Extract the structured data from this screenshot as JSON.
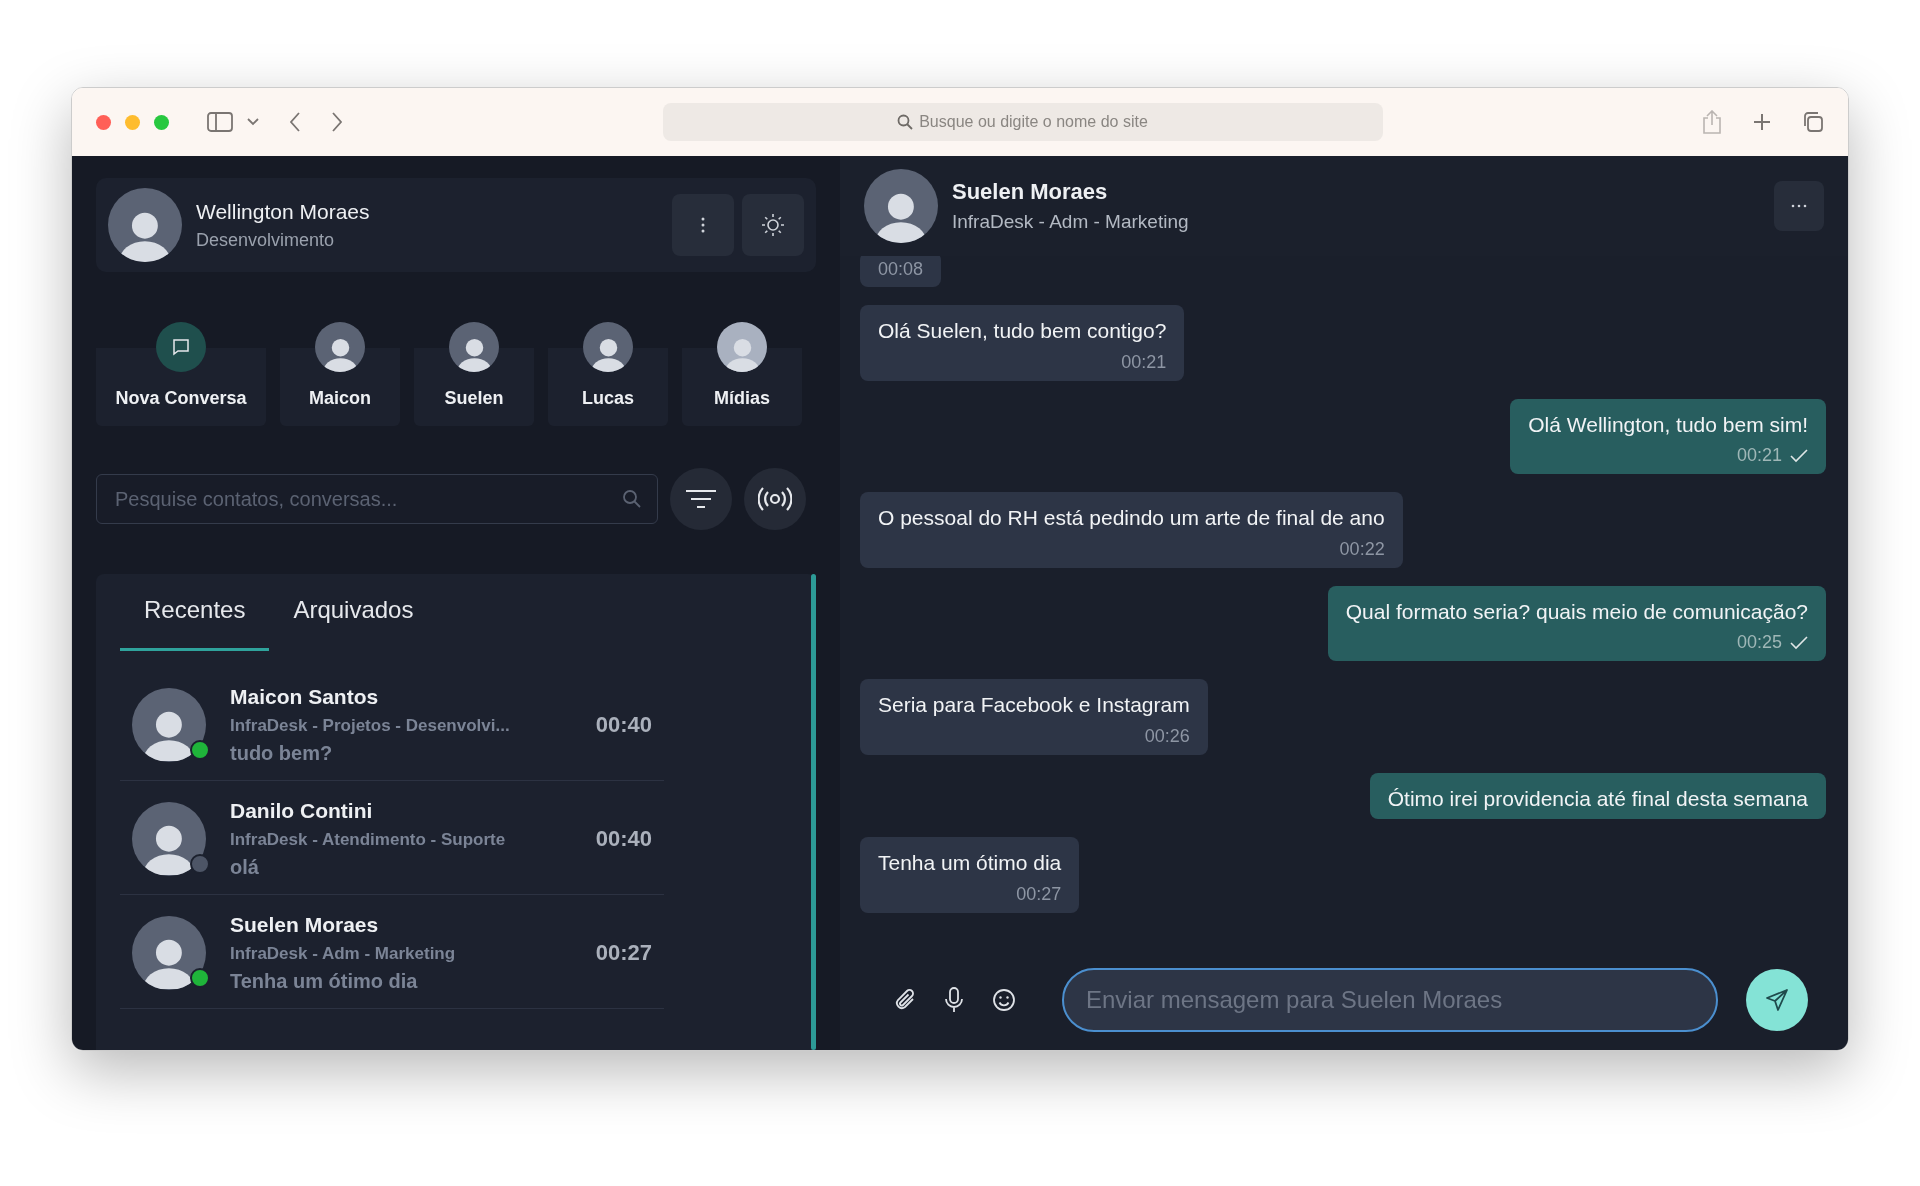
{
  "browser": {
    "address_placeholder": "Busque ou digite o nome do site"
  },
  "profile": {
    "name": "Wellington Moraes",
    "role": "Desenvolvimento"
  },
  "shortcuts": [
    {
      "kind": "action",
      "label": "Nova Conversa"
    },
    {
      "kind": "contact",
      "label": "Maicon"
    },
    {
      "kind": "contact",
      "label": "Suelen"
    },
    {
      "kind": "contact",
      "label": "Lucas"
    },
    {
      "kind": "media",
      "label": "Mídias"
    }
  ],
  "search": {
    "placeholder": "Pesquise contatos, conversas..."
  },
  "tabs": [
    {
      "label": "Recentes",
      "selected": true
    },
    {
      "label": "Arquivados",
      "selected": false
    }
  ],
  "conversations": [
    {
      "name": "Maicon Santos",
      "group": "InfraDesk - Projetos - Desenvolvi...",
      "preview": "tudo bem?",
      "time": "00:40",
      "online": true
    },
    {
      "name": "Danilo Contini",
      "group": "InfraDesk - Atendimento - Suporte",
      "preview": "olá",
      "time": "00:40",
      "online": false
    },
    {
      "name": "Suelen Moraes",
      "group": "InfraDesk - Adm - Marketing",
      "preview": "Tenha um ótimo dia",
      "time": "00:27",
      "online": true
    }
  ],
  "chat": {
    "name": "Suelen Moraes",
    "group": "InfraDesk - Adm - Marketing",
    "messages": [
      {
        "kind": "received",
        "time": "00:08",
        "check": false
      },
      {
        "kind": "received",
        "text": "Olá Suelen, tudo bem contigo?",
        "time": "00:21",
        "check": false
      },
      {
        "kind": "sent",
        "text": "Olá Wellington, tudo bem sim!",
        "time": "00:21",
        "check": true
      },
      {
        "kind": "received",
        "text": "O pessoal do RH está pedindo um arte de final de ano",
        "time": "00:22",
        "check": false
      },
      {
        "kind": "sent",
        "text": "Qual formato seria? quais meio de comunicação?",
        "time": "00:25",
        "check": true
      },
      {
        "kind": "received",
        "text": "Seria para Facebook e Instagram",
        "time": "00:26",
        "check": false
      },
      {
        "kind": "sent",
        "text": "Ótimo irei providencia até final desta semana",
        "check": false
      },
      {
        "kind": "received",
        "text": "Tenha um ótimo dia",
        "time": "00:27",
        "check": false
      }
    ],
    "composer": {
      "placeholder": "Enviar mensagem para Suelen Moraes"
    }
  }
}
